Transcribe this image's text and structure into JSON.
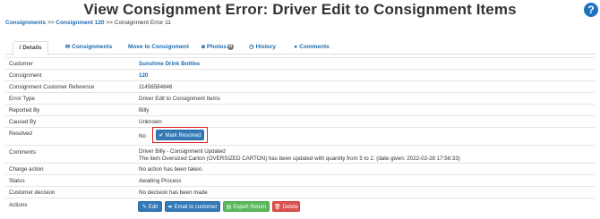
{
  "page": {
    "title": "View Consignment Error: Driver Edit to Consignment Items",
    "help_icon": "question-circle-icon",
    "help_glyph": "?"
  },
  "breadcrumb": {
    "items": [
      "Consignments",
      "Consignment 120",
      "Consignment Error 11"
    ],
    "separator": ">>"
  },
  "tabs": [
    {
      "label": "Details",
      "icon": "info-icon",
      "glyph": "i",
      "active": true
    },
    {
      "label": "Consignments",
      "icon": "envelope-icon",
      "glyph": "✉"
    },
    {
      "label": "Move to Consignment",
      "icon": "",
      "glyph": ""
    },
    {
      "label": "Photos",
      "icon": "camera-icon",
      "glyph": "◙",
      "badge": "0"
    },
    {
      "label": "History",
      "icon": "clock-icon",
      "glyph": "◷"
    },
    {
      "label": "Comments",
      "icon": "comment-icon",
      "glyph": "●"
    }
  ],
  "details": {
    "customer": {
      "label": "Customer",
      "value": "Sunshine Drink Bottles"
    },
    "consignment": {
      "label": "Consignment",
      "value": "120"
    },
    "reference": {
      "label": "Consignment Customer Reference",
      "value": "11456584846"
    },
    "error_type": {
      "label": "Error Type",
      "value": "Driver Edit to Consignment Items"
    },
    "reported_by": {
      "label": "Reported By",
      "value": "Billy"
    },
    "caused_by": {
      "label": "Caused By",
      "value": "Unknown"
    },
    "resolved": {
      "label": "Resolved",
      "value": "No",
      "button": "Mark Resolved",
      "button_glyph": "✔"
    },
    "comments": {
      "label": "Comments",
      "line1": "Driver Billy - Consignment Updated",
      "line2": "The item Oversized Carton (OVERSIZED CARTON) has been updated with quantity from 5 to 2. (date given: 2022-02-28 17:56:33)"
    },
    "charge_action": {
      "label": "Charge action",
      "value": "No action has been taken."
    },
    "status": {
      "label": "Status",
      "value": "Awaiting Process"
    },
    "customer_decision": {
      "label": "Customer decision",
      "value": "No decision has been made"
    },
    "actions": {
      "label": "Actions",
      "edit": "Edit",
      "edit_glyph": "✎",
      "email": "Email to customer",
      "email_glyph": "➦",
      "export": "Export Return",
      "export_glyph": "▤",
      "delete": "Delete",
      "delete_glyph": "🗑"
    }
  },
  "colors": {
    "link": "#1e6bb0",
    "primary": "#337ab7",
    "success": "#5cb85c",
    "danger": "#d9534f",
    "highlight": "#e02020"
  }
}
